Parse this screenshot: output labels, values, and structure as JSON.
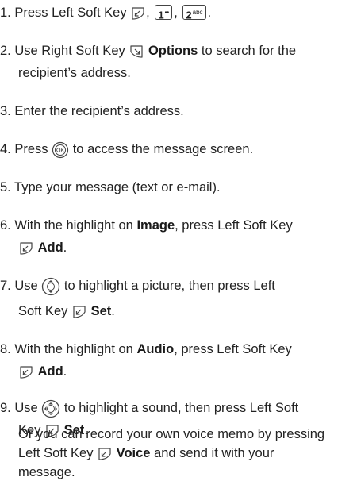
{
  "icons": {
    "left_soft_key": "left-soft-key-icon",
    "right_soft_key": "right-soft-key-icon",
    "ok_button": "ok-button-icon",
    "nav_updown": "navigation-up-down-icon",
    "nav_4way": "navigation-4-way-icon"
  },
  "keys": {
    "one_label": "1",
    "one_sup": "••",
    "two_label": "2",
    "two_sup": "abc",
    "ok_label": "OK"
  },
  "steps": {
    "s1": {
      "a": "1. Press Left Soft Key",
      "b": ",",
      "c": ",",
      "d": "."
    },
    "s2": {
      "a": "2. Use Right Soft Key",
      "b": "Options",
      "c": "to search for the",
      "d": "recipient’s address."
    },
    "s3": {
      "a": "3. Enter the recipient’s address."
    },
    "s4": {
      "a": "4. Press",
      "b": "to access the message screen."
    },
    "s5": {
      "a": "5. Type your message (text or e-mail)."
    },
    "s6": {
      "a": "6. With the highlight on",
      "b": "Image",
      "c": ", press Left Soft Key",
      "d": "Add",
      "e": "."
    },
    "s7": {
      "a": "7. Use",
      "b": "to highlight a picture, then press  Left",
      "c": "Soft Key",
      "d": "Set",
      "e": "."
    },
    "s8": {
      "a": "8. With the highlight on",
      "b": "Audio",
      "c": ", press Left Soft Key",
      "d": "Add",
      "e": "."
    },
    "s9": {
      "a": "9. Use",
      "b": "to highlight a sound, then press Left Soft",
      "c": "Key",
      "d": "Set",
      "e": ".",
      "f": "Or you can record your own voice memo by pressing",
      "g": "Left Soft Key",
      "h": "Voice",
      "i": "and send it with your",
      "j": "message."
    }
  }
}
